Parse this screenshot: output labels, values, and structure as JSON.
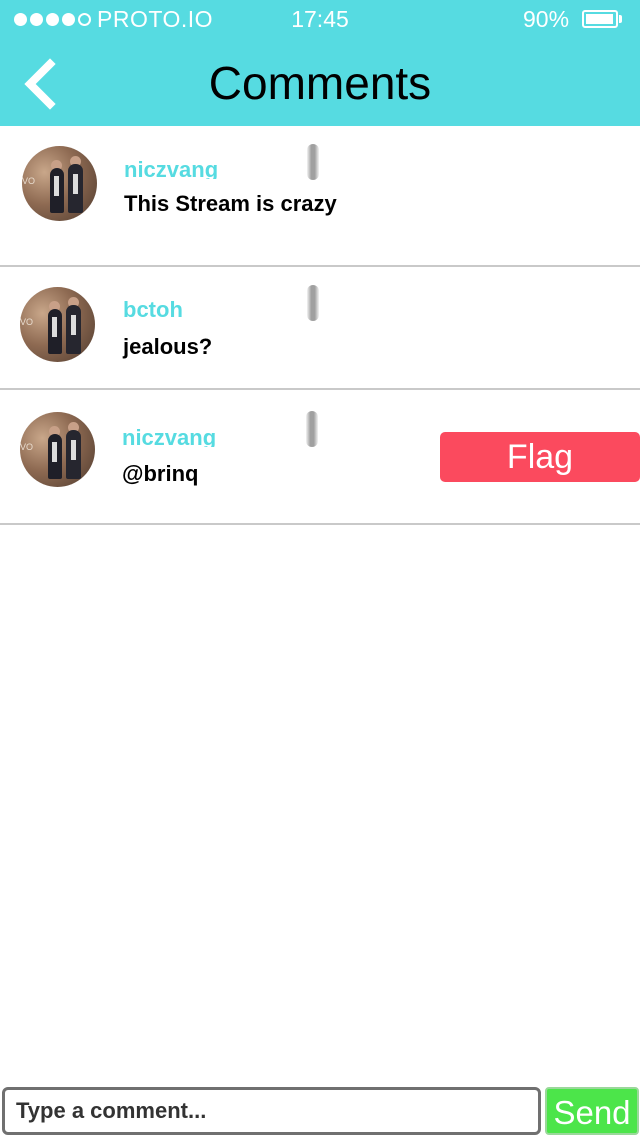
{
  "status_bar": {
    "carrier": "PROTO.IO",
    "time": "17:45",
    "battery_percent": "90%",
    "signal_bars_filled": 4,
    "signal_bars_total": 5
  },
  "header": {
    "title": "Comments",
    "back_icon": "chevron-left-icon",
    "background_color": "#56dbe1"
  },
  "comments": [
    {
      "username": "niczvang",
      "text": "This Stream is crazy"
    },
    {
      "username": "bctoh",
      "text": "jealous?"
    },
    {
      "username": "niczvang",
      "text": "@brinq"
    }
  ],
  "flag_button": {
    "label": "Flag",
    "color": "#fb4a5e"
  },
  "composer": {
    "placeholder": "Type a comment...",
    "value": "",
    "send_label": "Send",
    "send_color": "#4ce54a"
  },
  "colors": {
    "accent": "#56dbe1",
    "username": "#56dbe1",
    "divider": "#c9c9c9"
  }
}
